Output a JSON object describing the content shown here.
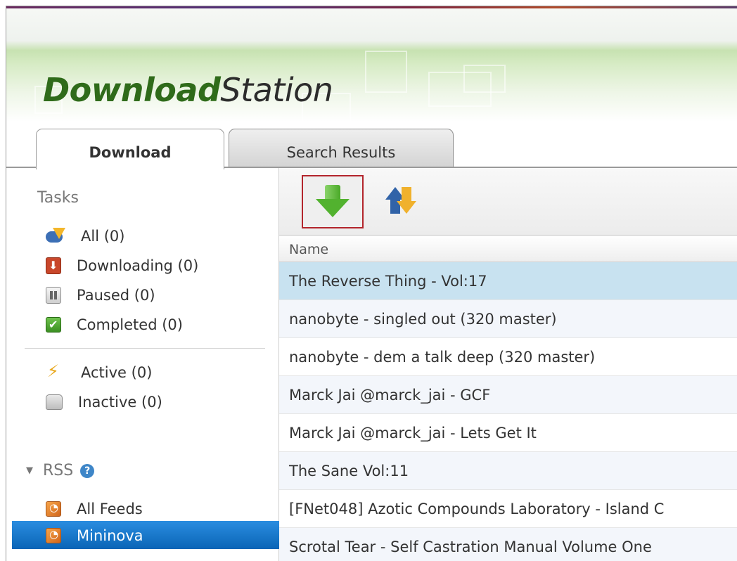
{
  "app": {
    "logo_bold": "Download",
    "logo_regular": "Station"
  },
  "tabs": [
    {
      "label": "Download",
      "active": true
    },
    {
      "label": "Search Results",
      "active": false
    }
  ],
  "sidebar": {
    "tasks_heading": "Tasks",
    "tasks": [
      {
        "label": "All (0)",
        "icon": "all-tasks-icon"
      },
      {
        "label": "Downloading (0)",
        "icon": "downloading-icon"
      },
      {
        "label": "Paused (0)",
        "icon": "paused-icon"
      },
      {
        "label": "Completed (0)",
        "icon": "completed-icon"
      },
      {
        "label": "Active (0)",
        "icon": "active-icon"
      },
      {
        "label": "Inactive (0)",
        "icon": "inactive-icon"
      }
    ],
    "rss_heading": "RSS",
    "feeds": [
      {
        "label": "All Feeds",
        "icon": "rss-icon",
        "selected": false
      },
      {
        "label": "Mininova",
        "icon": "rss-icon",
        "selected": true
      }
    ]
  },
  "toolbar": {
    "add_button_icon": "green-down-arrow-icon",
    "switch_button_icon": "swap-arrows-icon"
  },
  "table": {
    "column_name": "Name",
    "rows": [
      "The Reverse Thing - Vol:17",
      "nanobyte - singled out (320 master)",
      "nanobyte - dem a talk deep (320 master)",
      "Marck Jai @marck_jai - GCF",
      "Marck Jai @marck_jai - Lets Get It",
      "The Sane Vol:11",
      "[FNet048] Azotic Compounds Laboratory - Island C",
      "Scrotal Tear - Self Castration Manual Volume One"
    ],
    "selected_row": 0
  },
  "colors": {
    "brand_green": "#2f6b1a",
    "selection_blue": "#0a64b6",
    "row_selected": "#c8e2f0",
    "highlight_red": "#b3252c"
  }
}
